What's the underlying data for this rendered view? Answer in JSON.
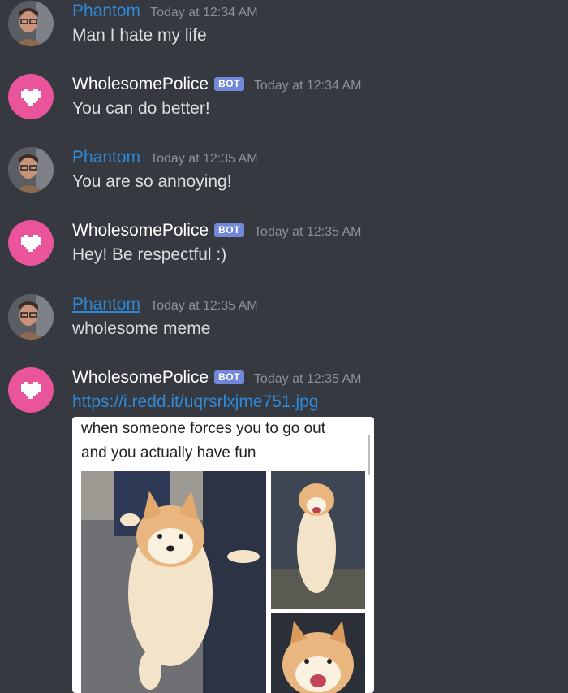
{
  "messages": [
    {
      "author": "Phantom",
      "bot_tag": "",
      "timestamp": "Today at 12:34 AM",
      "text": "Man I hate my life"
    },
    {
      "author": "WholesomePolice",
      "bot_tag": "BOT",
      "timestamp": "Today at 12:34 AM",
      "text": "You can do better!"
    },
    {
      "author": "Phantom",
      "bot_tag": "",
      "timestamp": "Today at 12:35 AM",
      "text": "You are so annoying!"
    },
    {
      "author": "WholesomePolice",
      "bot_tag": "BOT",
      "timestamp": "Today at 12:35 AM",
      "text": "Hey! Be respectful :)"
    },
    {
      "author": "Phantom",
      "bot_tag": "",
      "timestamp": "Today at 12:35 AM",
      "text": "wholesome meme"
    },
    {
      "author": "WholesomePolice",
      "bot_tag": "BOT",
      "timestamp": "Today at 12:35 AM",
      "text": "https://i.redd.it/uqrsrlxjme751.jpg"
    }
  ],
  "embed": {
    "caption": "when someone forces you to go out\nand you actually have fun"
  },
  "colors": {
    "background": "#36393f",
    "link": "#2e8ad8",
    "bot_tag": "#7289da",
    "bot_avatar": "#e9549a",
    "timestamp": "#8e9297"
  },
  "icons": {
    "bot_avatar": "pixel-heart-icon",
    "user_avatar": "user-photo-avatar"
  }
}
